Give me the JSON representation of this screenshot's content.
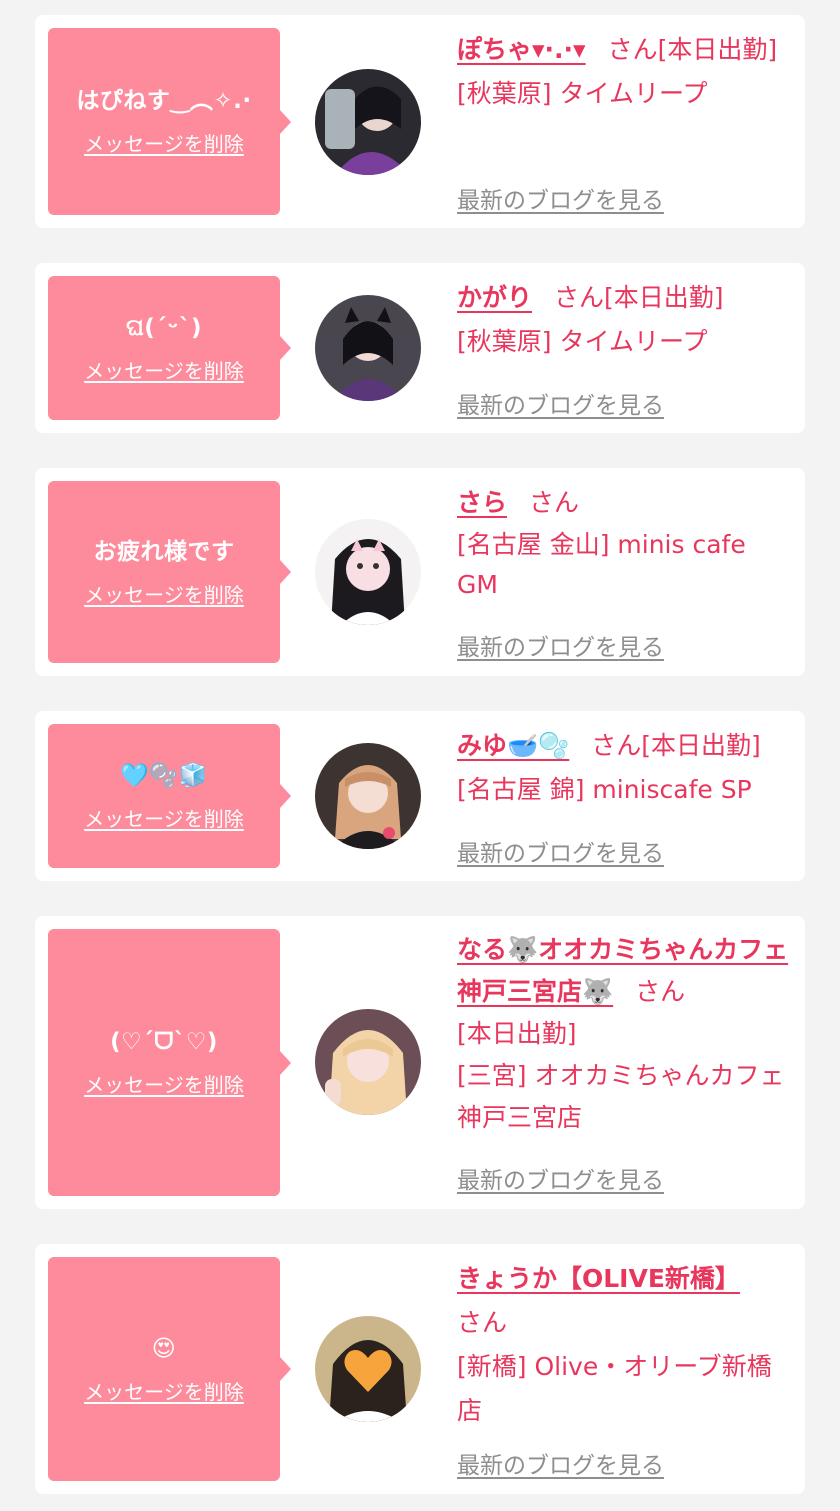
{
  "delete_label": "メッセージを削除",
  "blog_label": "最新のブログを見る",
  "colors": {
    "accent": "#e8365d",
    "bubble": "#fd8b9b",
    "blog_link": "#8e8e8e",
    "background": "#f3f3f3",
    "card": "#ffffff"
  },
  "cards": [
    {
      "message": "はぴねす‿︵✧.·",
      "name": "ぽちゃ▾·.·▾",
      "san": "さん",
      "status": "[本日出勤]",
      "location": "[秋葉原] タイムリープ"
    },
    {
      "message": "ଘ(ˊᵕˋ)",
      "name": "かがり",
      "san": "さん",
      "status": "[本日出勤]",
      "location": "[秋葉原] タイムリープ"
    },
    {
      "message": "お疲れ様です",
      "name": "さら",
      "san": "さん",
      "status": "",
      "location": "[名古屋 金山] minis cafe GM"
    },
    {
      "message": "🩵🫧🧊",
      "name": "みゆ🥣🫧",
      "san": "さん",
      "status": "[本日出勤]",
      "location": "[名古屋 錦] miniscafe SP"
    },
    {
      "message": "(♡ˊᗜˋ♡)",
      "name": "なる🐺オオカミちゃんカフェ神戸三宮店🐺",
      "san": "さん",
      "status": "[本日出勤]",
      "location": "[三宮] オオカミちゃんカフェ神戸三宮店"
    },
    {
      "message": "😍",
      "name": "きょうか【OLIVE新橋】",
      "san": "さん",
      "status": "",
      "location": "[新橋] Olive・オリーブ新橋店"
    }
  ]
}
